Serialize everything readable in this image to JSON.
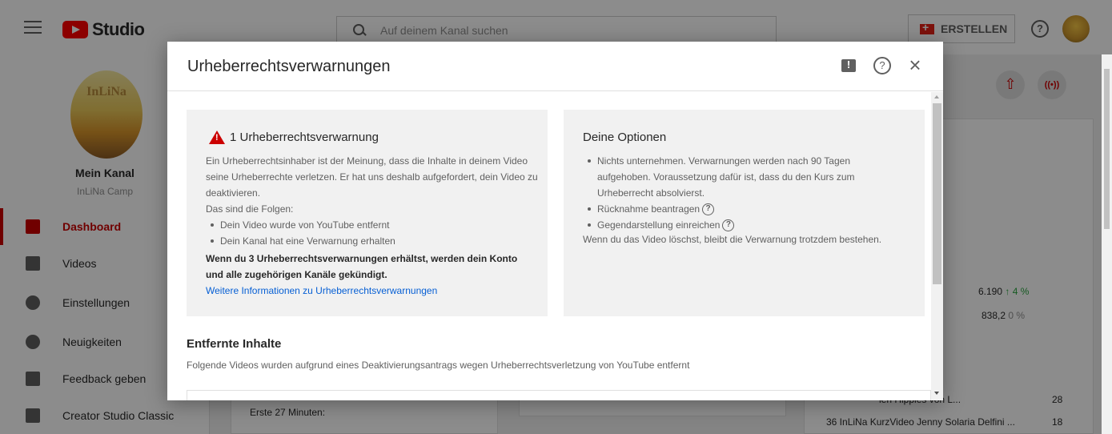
{
  "app": {
    "logo_text": "Studio",
    "search_placeholder": "Auf deinem Kanal suchen",
    "create_label": "ERSTELLEN",
    "help_glyph": "?"
  },
  "sidebar": {
    "channel_image_text": "InLiNa",
    "channel_title": "Mein Kanal",
    "channel_subtitle": "InLiNa Camp",
    "items": [
      {
        "label": "Dashboard",
        "icon": "dashboard-icon",
        "active": true
      },
      {
        "label": "Videos",
        "icon": "videos-icon",
        "active": false
      },
      {
        "label": "Einstellungen",
        "icon": "settings-gear-icon",
        "active": false
      },
      {
        "label": "Neuigkeiten",
        "icon": "news-badge-icon",
        "active": false
      },
      {
        "label": "Feedback geben",
        "icon": "feedback-icon",
        "active": false
      },
      {
        "label": "Creator Studio Classic",
        "icon": "creator-studio-classic-icon",
        "active": false
      }
    ]
  },
  "background": {
    "stat1_value": "6.190",
    "stat1_change": "4 %",
    "stat2_value": "838,2",
    "stat2_change": "0 %",
    "list_item1_text": "len Hippies von L...",
    "list_item1_count": "28",
    "list_item2_text": "36 InLiNa KurzVideo Jenny Solaria Delfini ...",
    "list_item2_count": "18",
    "card_text": "Erste 27 Minuten:"
  },
  "dialog": {
    "title": "Urheberrechtsverwarnungen",
    "close_glyph": "×",
    "warning_panel": {
      "title": "1 Urheberrechtsverwarnung",
      "description": "Ein Urheberrechtsinhaber ist der Meinung, dass die Inhalte in deinem Video seine Urheberrechte verletzen. Er hat uns deshalb aufgefordert, dein Video zu deaktivieren.",
      "consequences_intro": "Das sind die Folgen:",
      "consequences": [
        "Dein Video wurde von YouTube entfernt",
        "Dein Kanal hat eine Verwarnung erhalten"
      ],
      "termination_note": "Wenn du 3 Urheberrechtsverwarnungen erhältst, werden dein Konto und alle zugehörigen Kanäle gekündigt.",
      "learn_more_link": "Weitere Informationen zu Urheberrechtsverwarnungen"
    },
    "options_panel": {
      "title": "Deine Optionen",
      "options": [
        "Nichts unternehmen. Verwarnungen werden nach 90 Tagen aufgehoben. Voraussetzung dafür ist, dass du den Kurs zum Urheberrecht absolvierst.",
        "Rücknahme beantragen",
        "Gegendarstellung einreichen"
      ],
      "note": "Wenn du das Video löschst, bleibt die Verwarnung trotzdem bestehen."
    },
    "removed_section": {
      "title": "Entfernte Inhalte",
      "description": "Folgende Videos wurden aufgrund eines Deaktivierungsantrags wegen Urheberrechtsverletzung von YouTube entfernt"
    }
  }
}
